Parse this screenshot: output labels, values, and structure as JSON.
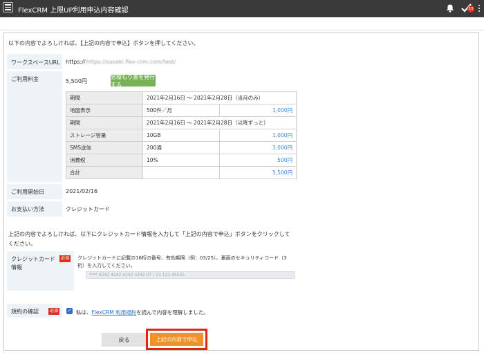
{
  "header": {
    "app_title": "FlexCRM 上限UP利用申込内容確認",
    "badge_count": "53"
  },
  "intro_text": "以下の内容でよろしければ、【上記の内容で申込】ボタンを押してください。",
  "workspace": {
    "label": "ワークスペースURL",
    "value": "https://sasaki.flex-crm.com/test/"
  },
  "fee": {
    "label": "ご利用料金",
    "total": "5,500円",
    "estimate_button": "見積もり書を発行する",
    "rows": [
      {
        "name": "期間",
        "desc": "2021年2月16日 ～ 2021年2月28日（当月のみ）",
        "amount": ""
      },
      {
        "name": "地図表示",
        "desc": "500件／月",
        "amount": "1,000円"
      },
      {
        "name": "期間",
        "desc": "2021年2月16日 ～ 2021年2月28日（以降ずっと）",
        "amount": ""
      },
      {
        "name": "ストレージ容量",
        "desc": "10GB",
        "amount": "1,000円"
      },
      {
        "name": "SMS送信",
        "desc": "200通",
        "amount": "3,000円"
      },
      {
        "name": "消費税",
        "desc": "10%",
        "amount": "500円"
      },
      {
        "name": "合計",
        "desc": "",
        "amount": "5,500円"
      }
    ]
  },
  "start_date": {
    "label": "ご利用開始日",
    "value": "2021/02/16"
  },
  "payment": {
    "label": "お支払い方法",
    "value": "クレジットカード"
  },
  "card_instruction_1": "上記の内容でよろしければ、以下にクレジットカード情報を入力して「上記の内容で申込」ボタンをクリックして",
  "card_instruction_2": "ください。",
  "card": {
    "label_1": "クレジットカード",
    "label_2": "情報",
    "required": "必須",
    "help_1": "クレジットカードに記載の16桁の番号、有効期限（例：03/25）、裏面のセキュリティコード（3",
    "help_2": "桁）を入力してください。",
    "input_value": "**** 4242 4242 4242 4242                    07 / 23  123    45555"
  },
  "terms": {
    "label": "規約の確認",
    "required": "必須",
    "prefix": "私は、",
    "link": "FlexCRM 利用規約",
    "suffix": "を読んで内容を理解しました。"
  },
  "buttons": {
    "back": "戻る",
    "submit": "上記の内容で申込"
  }
}
